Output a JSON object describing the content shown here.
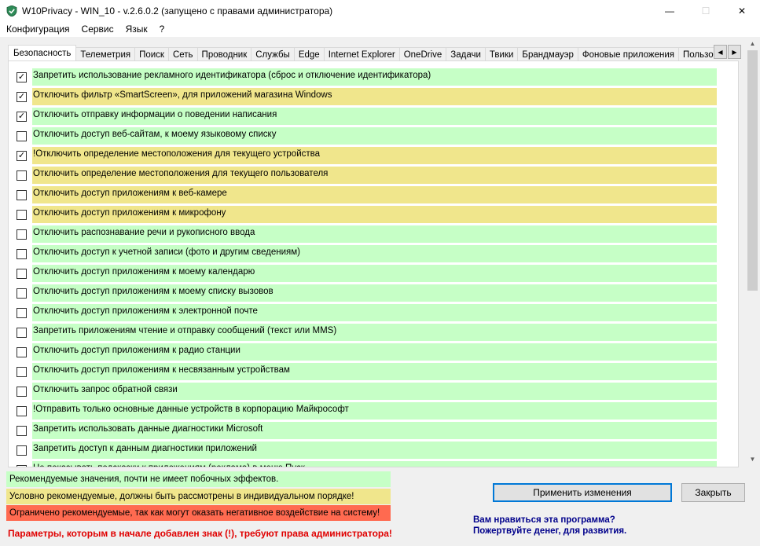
{
  "window": {
    "title": "W10Privacy - WIN_10 - v.2.6.0.2 (запущено с правами администратора)",
    "minimize_glyph": "—",
    "maximize_glyph": "☐",
    "close_glyph": "✕"
  },
  "menu": [
    {
      "label": "Конфигурация"
    },
    {
      "label": "Сервис"
    },
    {
      "label": "Язык"
    },
    {
      "label": "?"
    }
  ],
  "tabs": [
    {
      "label": "Безопасность",
      "active": true
    },
    {
      "label": "Телеметрия"
    },
    {
      "label": "Поиск"
    },
    {
      "label": "Сеть"
    },
    {
      "label": "Проводник"
    },
    {
      "label": "Службы"
    },
    {
      "label": "Edge"
    },
    {
      "label": "Internet Explorer"
    },
    {
      "label": "OneDrive"
    },
    {
      "label": "Задачи"
    },
    {
      "label": "Твики"
    },
    {
      "label": "Брандмауэр"
    },
    {
      "label": "Фоновые приложения"
    },
    {
      "label": "Пользов"
    }
  ],
  "tab_scroll": {
    "left_glyph": "◀",
    "right_glyph": "▶"
  },
  "colors": {
    "green": "#c6ffc6",
    "yellow": "#f0e68c",
    "red": "#ff6a50",
    "accent": "#0078d7",
    "admin_red": "#e00000",
    "donate_blue": "#00008b"
  },
  "settings": [
    {
      "label": "Запретить использование рекламного идентификатора (сброс и отключение идентификатора)",
      "checked": true,
      "color": "green"
    },
    {
      "label": "Отключить фильтр «SmartScreen», для приложений магазина Windows",
      "checked": true,
      "color": "yellow"
    },
    {
      "label": "Отключить отправку информации о поведении написания",
      "checked": true,
      "color": "green"
    },
    {
      "label": "Отключить доступ веб-сайтам, к моему языковому списку",
      "checked": false,
      "color": "green"
    },
    {
      "label": "!Отключить определение местоположения для текущего устройства",
      "checked": true,
      "color": "yellow"
    },
    {
      "label": "Отключить определение местоположения для текущего пользователя",
      "checked": false,
      "color": "yellow"
    },
    {
      "label": "Отключить доступ приложениям к веб-камере",
      "checked": false,
      "color": "yellow"
    },
    {
      "label": "Отключить доступ приложениям к микрофону",
      "checked": false,
      "color": "yellow"
    },
    {
      "label": "Отключить распознавание речи и рукописного ввода",
      "checked": false,
      "color": "green"
    },
    {
      "label": "Отключить доступ к учетной записи (фото и другим сведениям)",
      "checked": false,
      "color": "green"
    },
    {
      "label": "Отключить доступ приложениям к моему календарю",
      "checked": false,
      "color": "green"
    },
    {
      "label": "Отключить доступ приложениям к моему списку вызовов",
      "checked": false,
      "color": "green"
    },
    {
      "label": "Отключить доступ приложениям к электронной почте",
      "checked": false,
      "color": "green"
    },
    {
      "label": "Запретить приложениям чтение и отправку сообщений (текст или MMS)",
      "checked": false,
      "color": "green"
    },
    {
      "label": "Отключить доступ приложениям к радио станции",
      "checked": false,
      "color": "green"
    },
    {
      "label": "Отключить доступ приложениям к несвязанным устройствам",
      "checked": false,
      "color": "green"
    },
    {
      "label": "Отключить запрос обратной связи",
      "checked": false,
      "color": "green"
    },
    {
      "label": "!Отправить только основные данные устройств в корпорацию Майкрософт",
      "checked": false,
      "color": "green"
    },
    {
      "label": "Запретить использовать данные диагностики Microsoft",
      "checked": false,
      "color": "green"
    },
    {
      "label": "Запретить доступ к данным диагностики приложений",
      "checked": false,
      "color": "green"
    },
    {
      "label": "Не показывать подсказки к приложениям (реклама) в меню Пуск",
      "checked": false,
      "color": "green"
    }
  ],
  "scrollbar": {
    "up_glyph": "▲",
    "down_glyph": "▼"
  },
  "legend": {
    "green": "Рекомендуемые значения, почти не имеет побочных эффектов.",
    "yellow": "Условно рекомендуемые, должны быть рассмотрены в индивидуальном порядке!",
    "red": "Ограничено рекомендуемые, так как могут оказать негативное воздействие на систему!"
  },
  "admin_note": "Параметры, которым в начале добавлен знак (!), требуют права администратора!",
  "buttons": {
    "apply": "Применить изменения",
    "close": "Закрыть"
  },
  "donate": {
    "line1": "Вам нравиться эта программа?",
    "line2": "Пожертвуйте денег, для развития."
  }
}
